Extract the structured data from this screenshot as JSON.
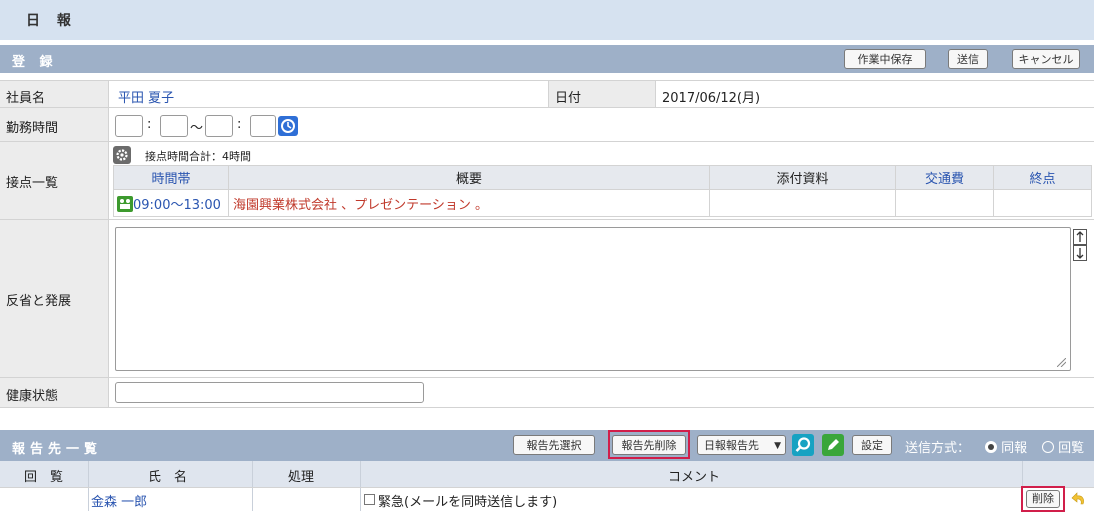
{
  "page": {
    "title": "日 報"
  },
  "register": {
    "header": "登 録",
    "buttons": {
      "save_draft": "作業中保存",
      "send": "送信",
      "cancel": "キャンセル"
    },
    "employee_label": "社員名",
    "employee_name": "平田 夏子",
    "date_label": "日付",
    "date_value": "2017/06/12(月)",
    "work_time_label": "勤務時間",
    "work_time": {
      "sep_colon": ":",
      "sep_range": "〜"
    },
    "contacts": {
      "label": "接点一覧",
      "total": "接点時間合計：4時間",
      "columns": {
        "time": "時間帯",
        "summary": "概要",
        "attachments": "添付資料",
        "travel": "交通費",
        "close": "終点"
      },
      "rows": [
        {
          "time": "09:00〜13:00",
          "summary": "海園興業株式会社 、プレゼンテーション 。",
          "attachments": "",
          "travel": "",
          "close": ""
        }
      ]
    },
    "reflection_label": "反省と発展",
    "health_label": "健康状態"
  },
  "report_list": {
    "header": "報告先一覧",
    "buttons": {
      "select": "報告先選択",
      "delete_targets": "報告先削除",
      "type_select": "日報報告先",
      "settings": "設定"
    },
    "send_method_label": "送信方式：",
    "send_options": [
      "同報",
      "回覧"
    ],
    "columns": {
      "circulation": "回　覧",
      "name": "氏　名",
      "process": "処理",
      "comment": "コメント"
    },
    "rows": [
      {
        "name": "金森 一郎",
        "process": "",
        "comment": "緊急(メールを同時送信します)",
        "delete": "削除"
      }
    ]
  },
  "colors": {
    "section_header": "#9eb0c8",
    "title_bar": "#d6e2f0",
    "highlight_red": "#d11e4a",
    "link_blue": "#2a55b0",
    "summary_red": "#c0392b"
  }
}
